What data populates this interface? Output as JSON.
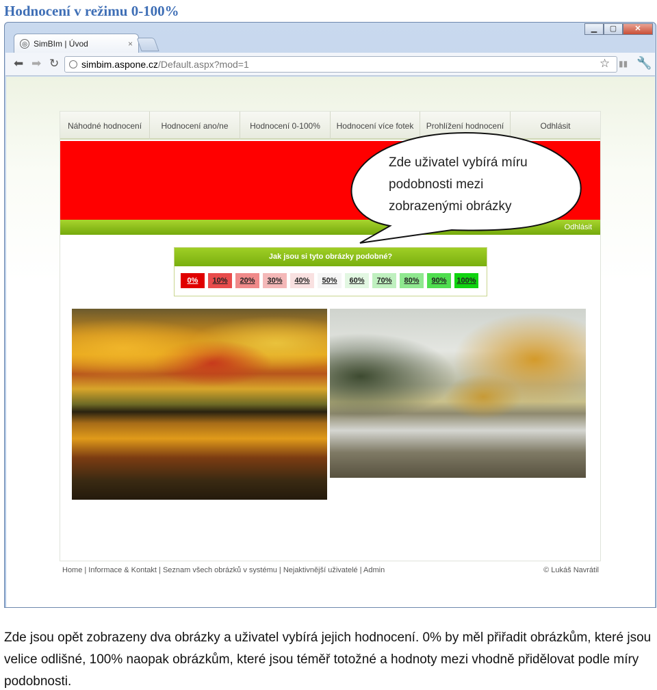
{
  "doc": {
    "heading": "Hodnocení v režimu 0-100%",
    "caption": "Zde jsou opět zobrazeny dva obrázky a uživatel vybírá jejich hodnocení. 0% by měl přiřadit obrázkům, které jsou velice odlišné, 100% naopak obrázkům, které jsou téměř totožné a hodnoty mezi vhodně přidělovat podle míry podobnosti."
  },
  "browser": {
    "tab_title": "SimBIm | Úvod",
    "tab_close": "×",
    "url_host": "simbim.aspone.cz",
    "url_path": "/Default.aspx?mod=1",
    "icons": {
      "back": "arrow-left-icon",
      "forward": "arrow-right-icon",
      "reload": "reload-icon",
      "star": "star-icon",
      "wrench": "wrench-icon"
    }
  },
  "site": {
    "menu": [
      "Náhodné hodnocení",
      "Hodnocení ano/ne",
      "Hodnocení 0-100%",
      "Hodnocení více fotek",
      "Prohlížení hodnocení",
      "Odhlásit"
    ],
    "greenbar_link": "Odhlásit",
    "rating_title": "Jak jsou si tyto obrázky podobné?",
    "rating_options": [
      {
        "label": "0%",
        "color": "#e00000"
      },
      {
        "label": "10%",
        "color": "#e84c4c"
      },
      {
        "label": "20%",
        "color": "#f08a8a"
      },
      {
        "label": "30%",
        "color": "#f4b8b8"
      },
      {
        "label": "40%",
        "color": "#f9e1e1"
      },
      {
        "label": "50%",
        "color": "#f5f5f5"
      },
      {
        "label": "60%",
        "color": "#e2f7e2"
      },
      {
        "label": "70%",
        "color": "#bff0bf"
      },
      {
        "label": "80%",
        "color": "#8fe88f"
      },
      {
        "label": "90%",
        "color": "#4fde4f"
      },
      {
        "label": "100%",
        "color": "#10d410"
      }
    ],
    "footer_links": "Home | Informace & Kontakt | Seznam všech obrázků v systému | Nejaktivnější uživatelé | Admin",
    "footer_copy": "© Lukáš Navrátil"
  },
  "callout": {
    "lines": [
      "Zde uživatel vybírá míru",
      "podobnosti mezi",
      "zobrazenými obrázky"
    ]
  }
}
